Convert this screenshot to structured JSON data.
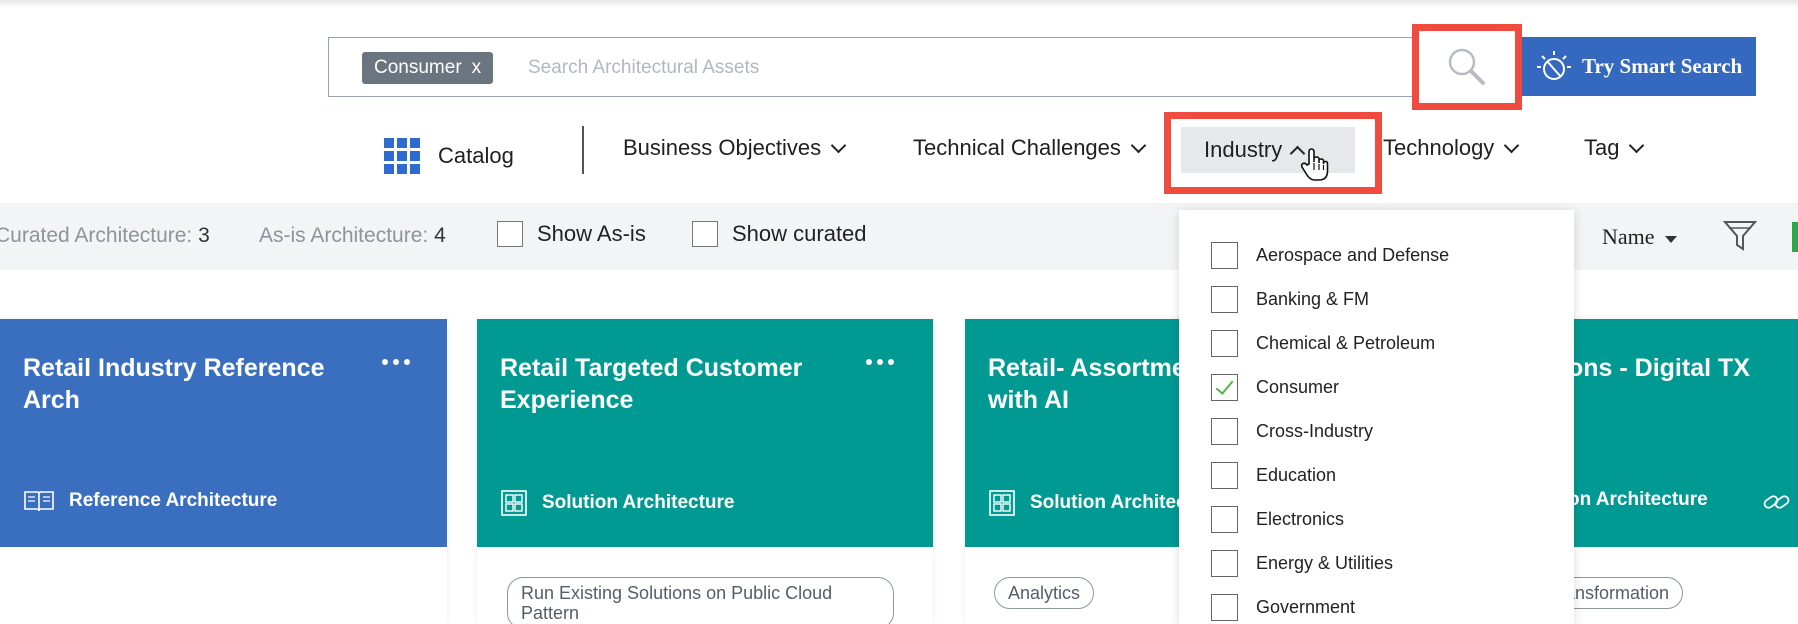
{
  "search": {
    "chip_label": "Consumer",
    "chip_remove": "x",
    "placeholder": "Search Architectural Assets",
    "smart_search_label": "Try Smart Search"
  },
  "nav": {
    "catalog": "Catalog",
    "items": [
      {
        "label": "Business Objectives"
      },
      {
        "label": "Technical Challenges"
      },
      {
        "label": "Industry"
      },
      {
        "label": "Technology"
      },
      {
        "label": "Tag"
      }
    ]
  },
  "filters": {
    "curated_label": "Curated Architecture: ",
    "curated_count": "3",
    "asis_label": "As-is Architecture: ",
    "asis_count": "4",
    "show_asis": "Show As-is",
    "show_curated": "Show curated",
    "sort_value": "Name"
  },
  "cards": [
    {
      "title": "Retail Industry Reference Arch",
      "type": "Reference Architecture",
      "color": "#3a6fbf"
    },
    {
      "title": "Retail Targeted Customer Experience",
      "type": "Solution Architecture",
      "color": "#009a93",
      "tags": [
        "Run Existing Solutions on Public Cloud Pattern"
      ]
    },
    {
      "title": "Retail- Assortme with AI",
      "type": "Solution Architecture",
      "color": "#009a93",
      "tags": [
        "Analytics"
      ]
    },
    {
      "title": "ons - Digital TX",
      "type": "on Architecture",
      "color": "#009a93",
      "tags": [
        "e Transformation"
      ]
    }
  ],
  "industry_dropdown": {
    "options": [
      {
        "label": "Aerospace and Defense",
        "checked": false
      },
      {
        "label": "Banking & FM",
        "checked": false
      },
      {
        "label": "Chemical & Petroleum",
        "checked": false
      },
      {
        "label": "Consumer",
        "checked": true
      },
      {
        "label": "Cross-Industry",
        "checked": false
      },
      {
        "label": "Education",
        "checked": false
      },
      {
        "label": "Electronics",
        "checked": false
      },
      {
        "label": "Energy & Utilities",
        "checked": false
      },
      {
        "label": "Government",
        "checked": false
      }
    ]
  },
  "colors": {
    "primary_blue": "#3569c0",
    "teal": "#009a93",
    "highlight_red": "#f04b3e",
    "check_green": "#50b845"
  }
}
